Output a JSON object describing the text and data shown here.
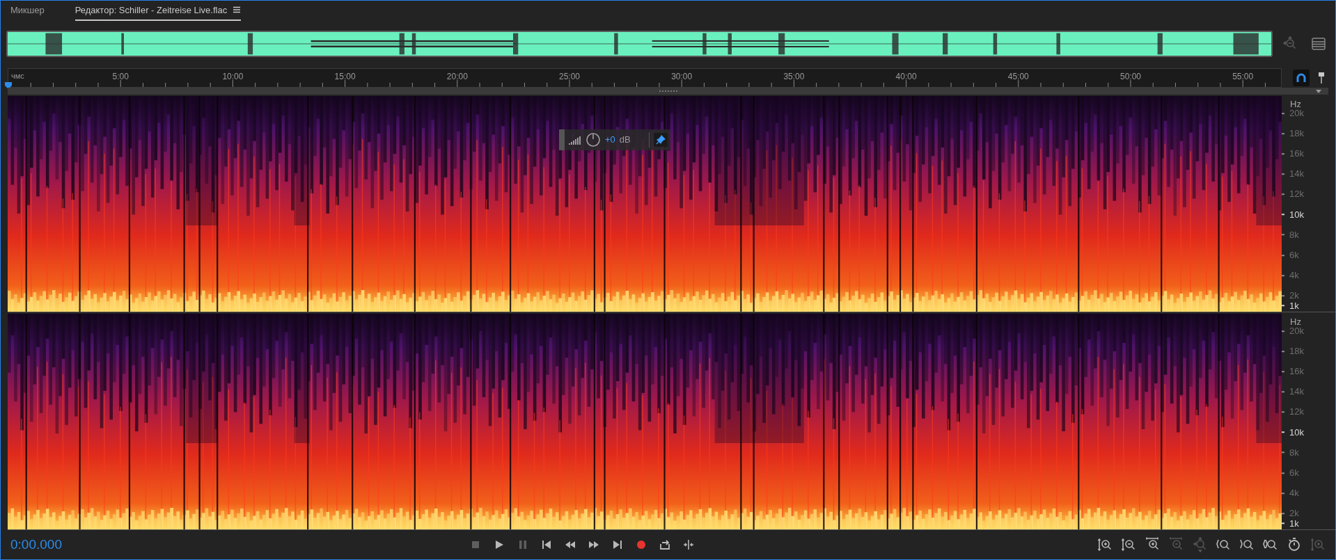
{
  "tabs": [
    {
      "label": "Микшер",
      "selected": false
    },
    {
      "label": "Редактор: Schiller - Zeitreise Live.flac",
      "selected": true
    }
  ],
  "ruler": {
    "unit_label": "чмс",
    "ticks": [
      "5:00",
      "10:00",
      "15:00",
      "20:00",
      "25:00",
      "30:00",
      "35:00",
      "40:00",
      "45:00",
      "50:00",
      "55:00"
    ]
  },
  "snapping": {
    "on": true
  },
  "hud": {
    "gain": "+0",
    "unit": "dB",
    "pinned": true
  },
  "channels": [
    {
      "axis_unit": "Hz",
      "labels": [
        {
          "text": "20k",
          "major": false
        },
        {
          "text": "18k",
          "major": false
        },
        {
          "text": "16k",
          "major": false
        },
        {
          "text": "14k",
          "major": false
        },
        {
          "text": "12k",
          "major": false
        },
        {
          "text": "10k",
          "major": true
        },
        {
          "text": "8k",
          "major": false
        },
        {
          "text": "6k",
          "major": false
        },
        {
          "text": "4k",
          "major": false
        },
        {
          "text": "2k",
          "major": false
        },
        {
          "text": "1k",
          "major": true
        }
      ]
    },
    {
      "axis_unit": "Hz",
      "labels": [
        {
          "text": "20k",
          "major": false
        },
        {
          "text": "18k",
          "major": false
        },
        {
          "text": "16k",
          "major": false
        },
        {
          "text": "14k",
          "major": false
        },
        {
          "text": "12k",
          "major": false
        },
        {
          "text": "10k",
          "major": true
        },
        {
          "text": "8k",
          "major": false
        },
        {
          "text": "6k",
          "major": false
        },
        {
          "text": "4k",
          "major": false
        },
        {
          "text": "2k",
          "major": false
        },
        {
          "text": "1k",
          "major": true
        }
      ]
    }
  ],
  "time": "0:00.000",
  "transport": [
    {
      "kind": "stop",
      "disabled": true
    },
    {
      "kind": "play",
      "disabled": false
    },
    {
      "kind": "pause",
      "disabled": true
    },
    {
      "kind": "to-start",
      "disabled": false
    },
    {
      "kind": "rewind",
      "disabled": false
    },
    {
      "kind": "forward",
      "disabled": false
    },
    {
      "kind": "to-end",
      "disabled": false
    },
    {
      "kind": "record",
      "disabled": false
    },
    {
      "kind": "loop",
      "disabled": false
    },
    {
      "kind": "skip-selection",
      "disabled": false
    }
  ],
  "zoom_tools": [
    {
      "kind": "amp-in",
      "disabled": false
    },
    {
      "kind": "amp-out",
      "disabled": false
    },
    {
      "kind": "time-in",
      "disabled": false
    },
    {
      "kind": "time-out",
      "disabled": true
    },
    {
      "kind": "full",
      "disabled": true
    },
    {
      "kind": "in-left",
      "disabled": false
    },
    {
      "kind": "in-right",
      "disabled": false
    },
    {
      "kind": "selection",
      "disabled": false
    },
    {
      "kind": "timer",
      "disabled": false
    },
    {
      "kind": "amp-reset",
      "disabled": true
    }
  ]
}
